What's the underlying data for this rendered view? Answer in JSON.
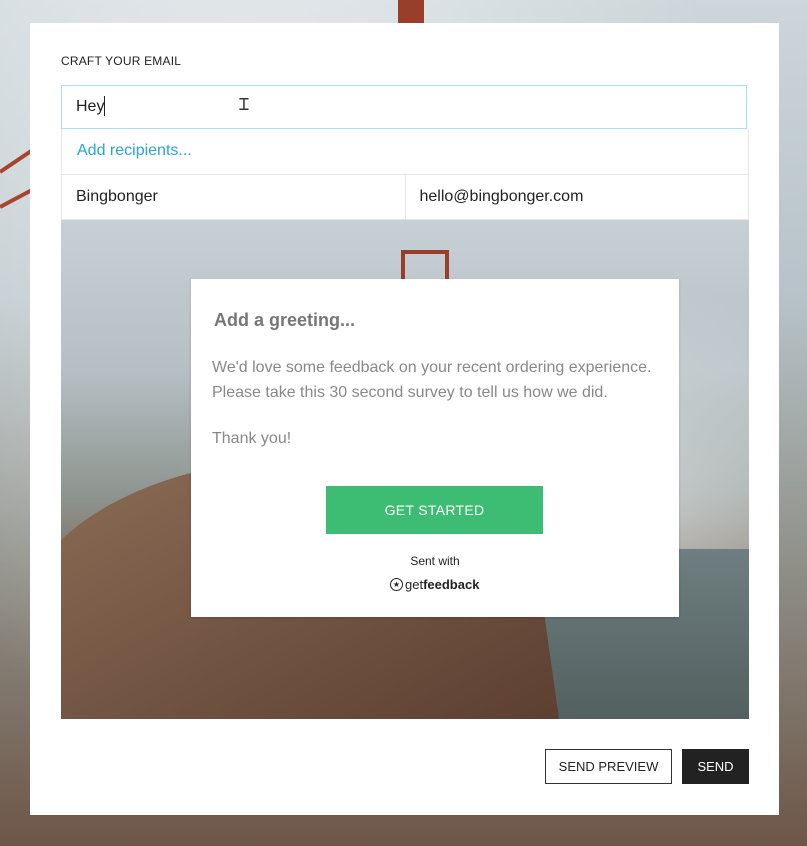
{
  "form": {
    "section_label": "CRAFT YOUR EMAIL",
    "subject_value": "Hey",
    "add_recipients_label": "Add recipients...",
    "recipient": {
      "name": "Bingbonger",
      "email": "hello@bingbonger.com"
    }
  },
  "email_preview": {
    "greeting": "Add a greeting...",
    "body_line1": "We'd love some feedback on your recent ordering experience.",
    "body_line2": "Please take this 30 second survey to tell us how we did.",
    "thanks": "Thank you!",
    "cta_label": "GET STARTED",
    "sent_with": "Sent with",
    "brand_light": "get",
    "brand_bold": "feedback",
    "cta_color": "#3dbd73"
  },
  "actions": {
    "send_preview_label": "SEND PREVIEW",
    "send_label": "SEND"
  },
  "colors": {
    "link": "#2aa3dc",
    "input_border": "#aee0ee",
    "primary_button": "#222222"
  }
}
